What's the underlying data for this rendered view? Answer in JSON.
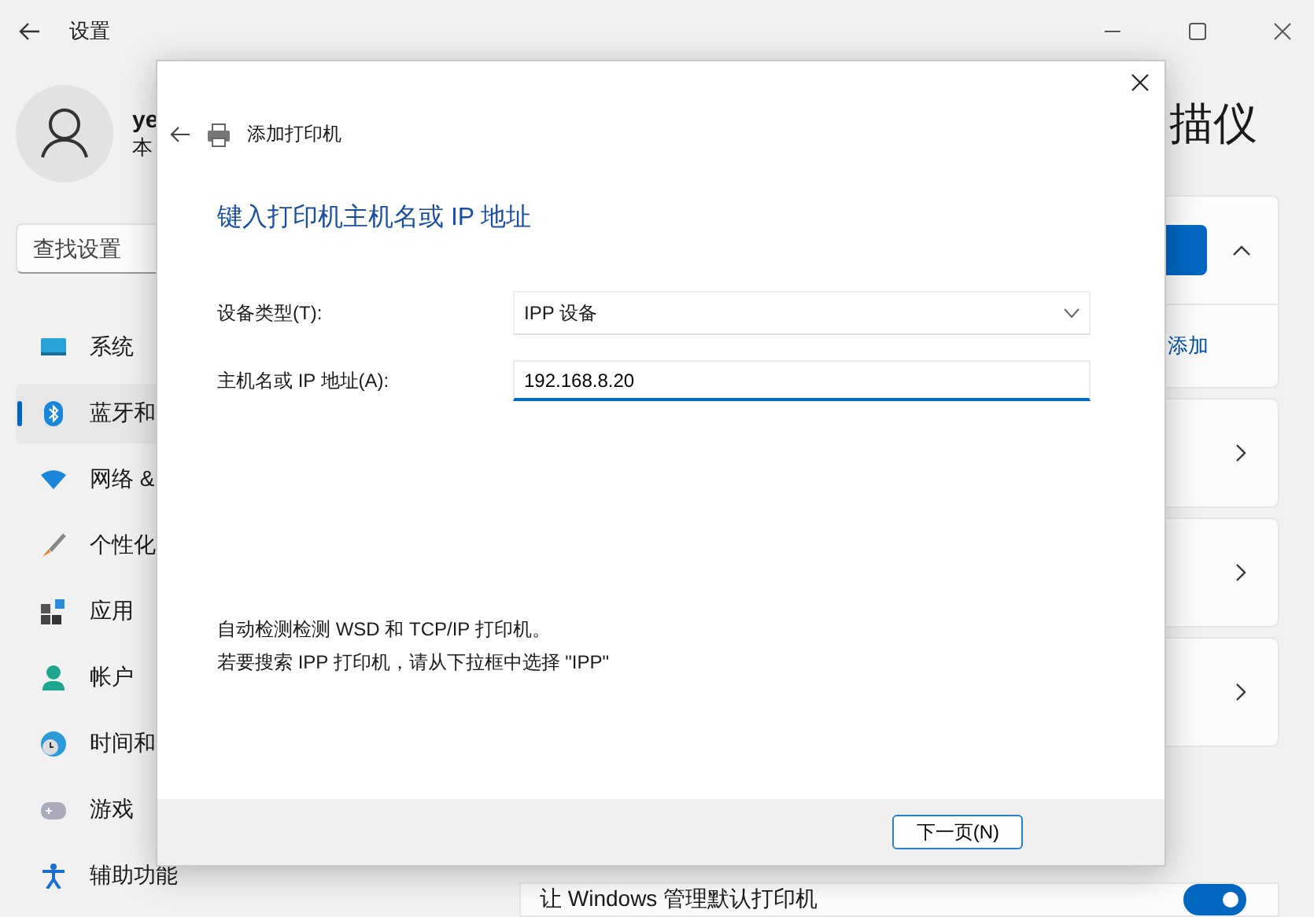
{
  "window": {
    "title": "设置"
  },
  "user": {
    "name": "ye",
    "subtitle": "本"
  },
  "search": {
    "placeholder": "查找设置"
  },
  "sidebar": {
    "items": [
      {
        "label": "系统",
        "selected": false
      },
      {
        "label": "蓝牙和",
        "selected": true
      },
      {
        "label": "网络 &",
        "selected": false
      },
      {
        "label": "个性化",
        "selected": false
      },
      {
        "label": "应用",
        "selected": false
      },
      {
        "label": "帐户",
        "selected": false
      },
      {
        "label": "时间和",
        "selected": false
      },
      {
        "label": "游戏",
        "selected": false
      },
      {
        "label": "辅助功能",
        "selected": false
      }
    ]
  },
  "page": {
    "title": "描仪",
    "add_link": "添加",
    "default_printer": {
      "label": "让 Windows 管理默认打印机",
      "on": true
    }
  },
  "dialog": {
    "title": "添加打印机",
    "heading": "键入打印机主机名或 IP 地址",
    "fields": [
      {
        "kind": "select",
        "label": "设备类型(T):",
        "value": "IPP 设备"
      },
      {
        "kind": "input",
        "label": "主机名或 IP 地址(A):",
        "value": "192.168.8.20"
      }
    ],
    "hints": [
      "自动检测检测 WSD 和 TCP/IP 打印机。",
      "若要搜索 IPP 打印机，请从下拉框中选择 \"IPP\""
    ],
    "buttons": [
      "下一页(N)"
    ]
  }
}
